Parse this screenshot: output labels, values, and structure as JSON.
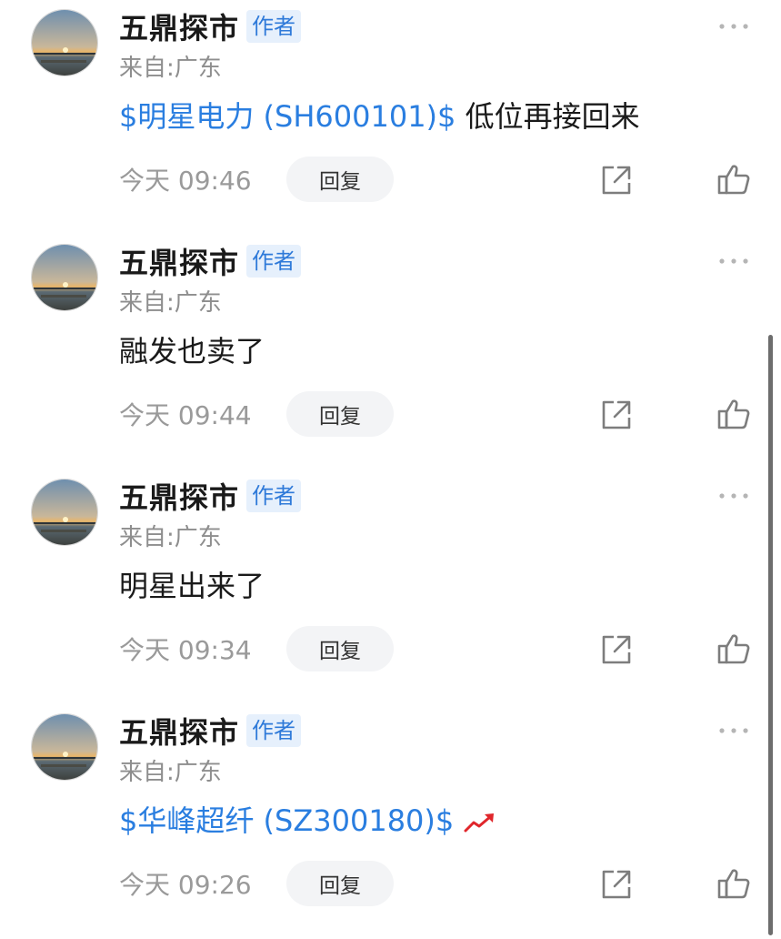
{
  "posts": [
    {
      "author": "五鼎探市",
      "badge": "作者",
      "location": "来自:广东",
      "stock": "$明星电力 (SH600101)$",
      "text": " 低位再接回来",
      "time": "今天 09:46",
      "reply_label": "回复"
    },
    {
      "author": "五鼎探市",
      "badge": "作者",
      "location": "来自:广东",
      "text": "融发也卖了",
      "time": "今天 09:44",
      "reply_label": "回复"
    },
    {
      "author": "五鼎探市",
      "badge": "作者",
      "location": "来自:广东",
      "text": "明星出来了",
      "time": "今天 09:34",
      "reply_label": "回复"
    },
    {
      "author": "五鼎探市",
      "badge": "作者",
      "location": "来自:广东",
      "stock": "$华峰超纤 (SZ300180)$",
      "time": "今天 09:26",
      "reply_label": "回复",
      "trend_icon": "trend-up-icon"
    }
  ],
  "icons": {
    "more": "more-dots-icon",
    "share": "share-icon",
    "like": "thumbs-up-icon"
  },
  "colors": {
    "link": "#2a7ee0",
    "badge_text": "#2f7ad9",
    "badge_bg": "#e6f0fc",
    "trend": "#e0262b"
  }
}
